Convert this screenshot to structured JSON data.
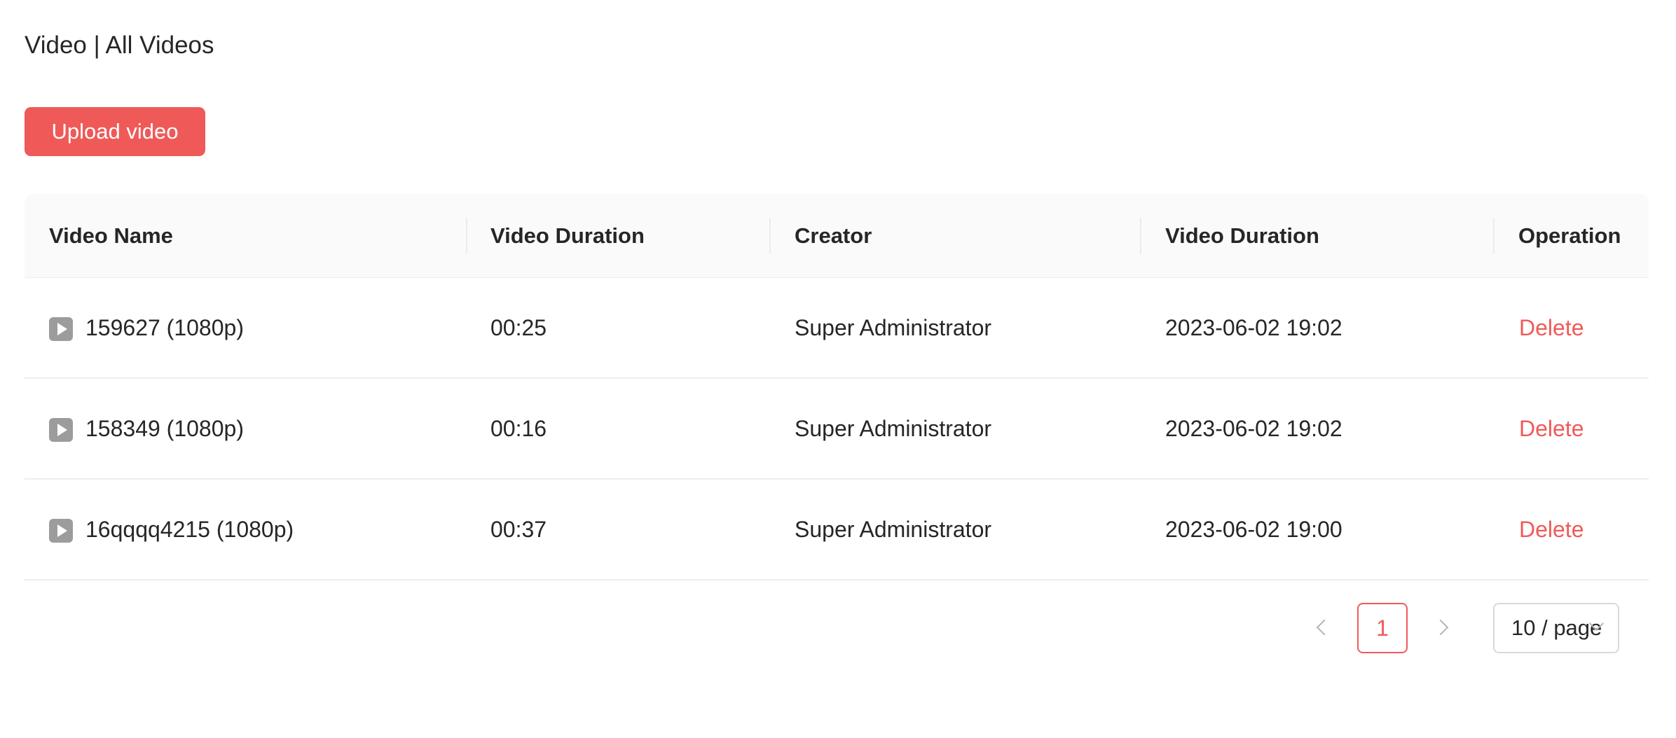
{
  "page_title": "Video | All Videos",
  "upload_button": "Upload video",
  "table": {
    "columns": [
      "Video Name",
      "Video Duration",
      "Creator",
      "Video Duration",
      "Operation"
    ],
    "rows": [
      {
        "name": "159627 (1080p)",
        "duration": "00:25",
        "creator": "Super Administrator",
        "date": "2023-06-02 19:02",
        "action": "Delete"
      },
      {
        "name": "158349 (1080p)",
        "duration": "00:16",
        "creator": "Super Administrator",
        "date": "2023-06-02 19:02",
        "action": "Delete"
      },
      {
        "name": "16qqqq4215 (1080p)",
        "duration": "00:37",
        "creator": "Super Administrator",
        "date": "2023-06-02 19:00",
        "action": "Delete"
      }
    ],
    "row_icon": "play-icon"
  },
  "pagination": {
    "current_page": "1",
    "page_size": "10 / page"
  },
  "colors": {
    "accent": "#ef5a58",
    "header_bg": "#fafafa",
    "text": "#262626"
  }
}
